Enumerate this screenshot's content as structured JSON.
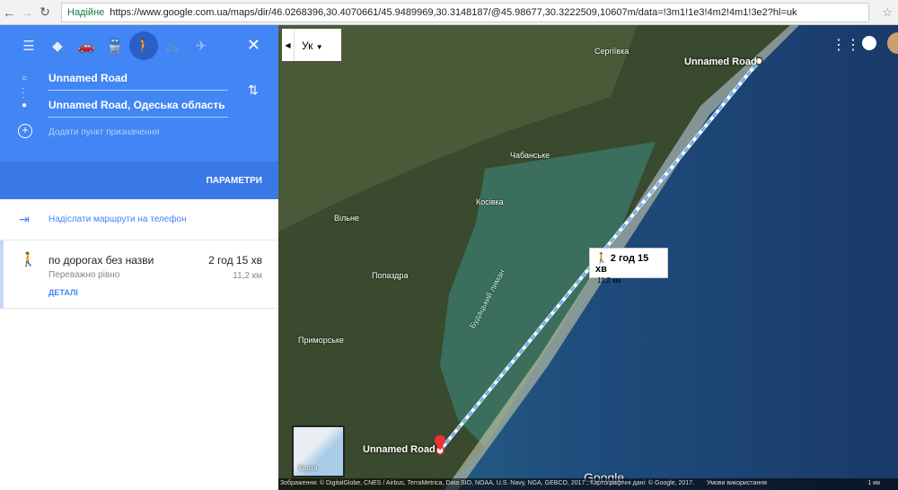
{
  "browser": {
    "secure_label": "Надійне",
    "url": "https://www.google.com.ua/maps/dir/46.0268396,30.4070661/45.9489969,30.3148187/@45.98677,30.3222509,10607m/data=!3m1!1e3!4m2!4m1!3e2?hl=uk"
  },
  "sidebar": {
    "modes": [
      "directions",
      "car",
      "transit",
      "walk",
      "bike",
      "flight"
    ],
    "origin": "Unnamed Road",
    "destination": "Unnamed Road, Одеська область",
    "add_destination": "Додати пункт призначення",
    "options": "ПАРАМЕТРИ",
    "send_to_phone": "Надіслати маршрути на телефон",
    "route": {
      "name": "по дорогах без назви",
      "subtitle": "Переважно рівно",
      "time": "2 год 15 хв",
      "distance": "11,2 км",
      "details": "ДЕТАЛІ"
    }
  },
  "map": {
    "language": "Ук",
    "places": [
      "Сергіївка",
      "Чабанське",
      "Косівка",
      "Вільне",
      "Попаздра",
      "Приморське",
      "Будацький лиман"
    ],
    "start_label": "Unnamed Road",
    "end_label": "Unnamed Road",
    "card": {
      "time": "2 год 15 хв",
      "distance": "11,2 км"
    },
    "minimap_label": "Карта",
    "logo": "Google",
    "attribution": "Зображення: © DigitalGlobe, CNES / Airbus, TerraMetrica, Data SIO, NOAA, U.S. Navy, NGA, GEBCO, 2017., Картографічні дані: © Google, 2017.",
    "terms": "Умови використання",
    "scale": "1 км",
    "route_color": "#6fb3f0"
  }
}
